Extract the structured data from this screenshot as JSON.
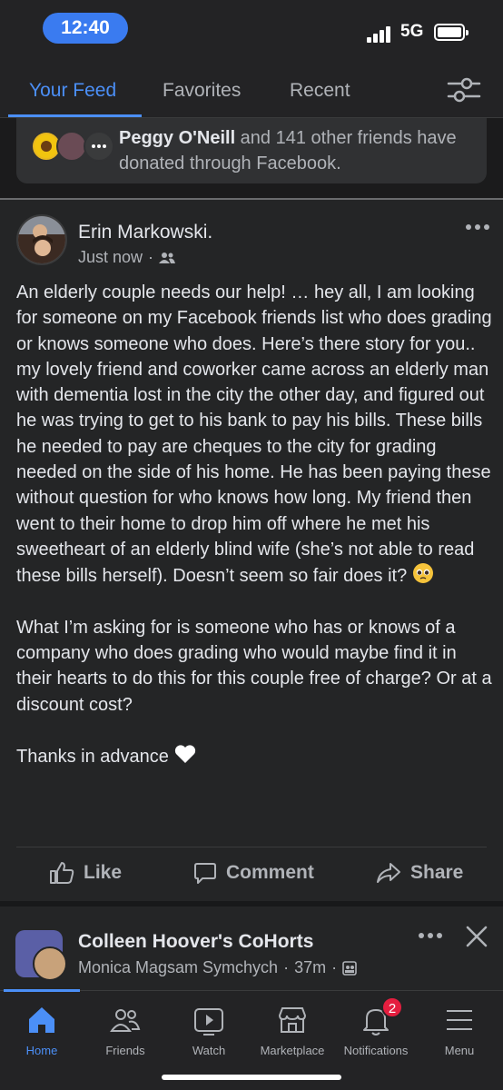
{
  "status": {
    "time": "12:40",
    "network": "5G"
  },
  "tabs": [
    {
      "label": "Your Feed",
      "active": true
    },
    {
      "label": "Favorites",
      "active": false
    },
    {
      "label": "Recent",
      "active": false
    }
  ],
  "donation": {
    "name": "Peggy O'Neill",
    "text": " and 141 other friends have donated through Facebook."
  },
  "post": {
    "author": "Erin Markowski.",
    "time": "Just now",
    "paragraphs": [
      "An elderly couple needs our help! … hey all, I am looking for someone on my Facebook friends list who does grading or knows someone who does. Here’s there story for you.. my lovely friend and coworker came across an elderly man with dementia lost in the city the other day, and figured out he was trying to get to his bank to pay his bills. These bills he needed to pay are cheques to the city for grading needed on the side of his home. He has been paying these without question for who knows how long. My friend then went to their home to drop him off where he met his sweetheart of an elderly blind wife (she’s not able to read these bills herself). Doesn’t seem so fair does it?",
      "What I’m asking for is someone who has or knows of a company who does grading who would maybe find it in their hearts to do this for this couple free of charge? Or at a discount cost?",
      "Thanks in advance"
    ],
    "actions": {
      "like": "Like",
      "comment": "Comment",
      "share": "Share"
    }
  },
  "next_post": {
    "group": "Colleen Hoover's CoHorts",
    "author": "Monica Magsam Symchych",
    "time": "37m"
  },
  "bottom_nav": [
    {
      "label": "Home",
      "icon": "home-icon",
      "active": true
    },
    {
      "label": "Friends",
      "icon": "friends-icon",
      "active": false
    },
    {
      "label": "Watch",
      "icon": "watch-icon",
      "active": false
    },
    {
      "label": "Marketplace",
      "icon": "marketplace-icon",
      "active": false
    },
    {
      "label": "Notifications",
      "icon": "bell-icon",
      "active": false,
      "badge": "2"
    },
    {
      "label": "Menu",
      "icon": "menu-icon",
      "active": false
    }
  ],
  "colors": {
    "accent": "#4b8ff7",
    "background": "#242526",
    "badge": "#e41e3f",
    "time_pill": "#3a7bf0"
  }
}
